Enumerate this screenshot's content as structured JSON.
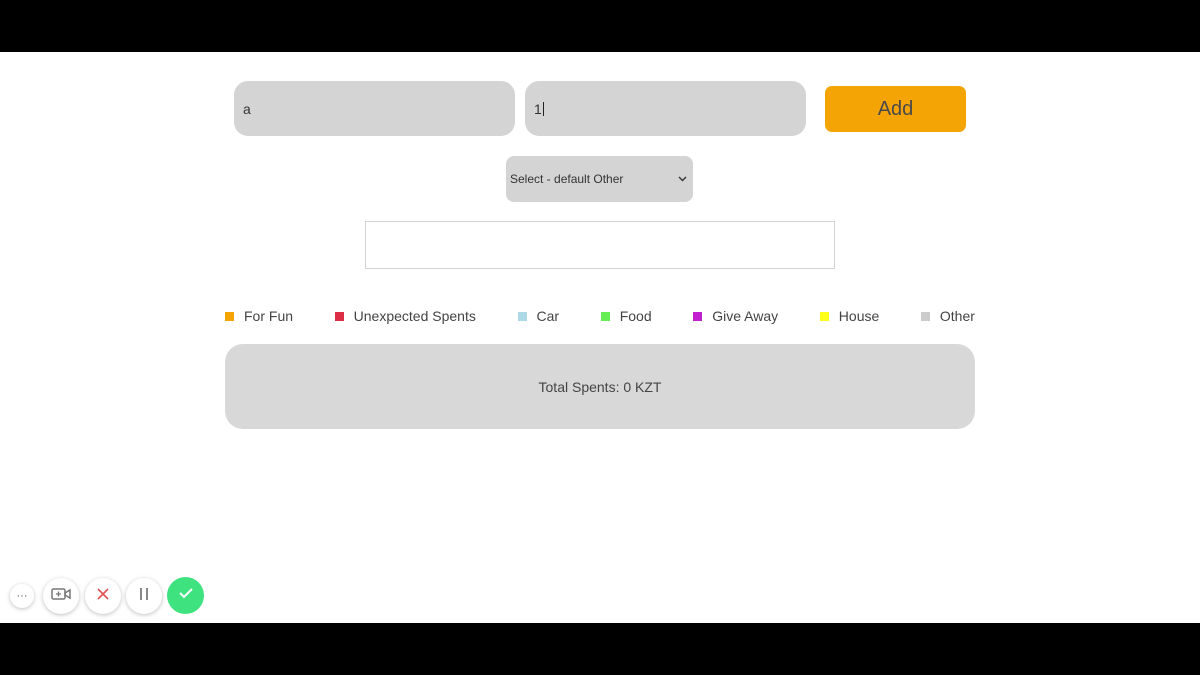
{
  "form": {
    "name_value": "a",
    "amount_value": "1",
    "add_label": "Add",
    "category_select": {
      "selected": "Select - default Other"
    }
  },
  "legend": [
    {
      "label": "For Fun",
      "color": "#f5a406"
    },
    {
      "label": "Unexpected Spents",
      "color": "#dc2f45"
    },
    {
      "label": "Car",
      "color": "#add8e6"
    },
    {
      "label": "Food",
      "color": "#66ee55"
    },
    {
      "label": "Give Away",
      "color": "#c21fcf"
    },
    {
      "label": "House",
      "color": "#ffff1a"
    },
    {
      "label": "Other",
      "color": "#cccccc"
    }
  ],
  "summary": {
    "total_text": "Total Spents: 0 KZT"
  },
  "recorder": {
    "more_icon": "ellipsis-icon",
    "camera_icon": "camera-icon",
    "cancel_icon": "close-icon",
    "pause_icon": "pause-icon",
    "done_icon": "checkmark-icon",
    "colors": {
      "cancel": "#e05252",
      "done": "#3ee27f"
    }
  }
}
